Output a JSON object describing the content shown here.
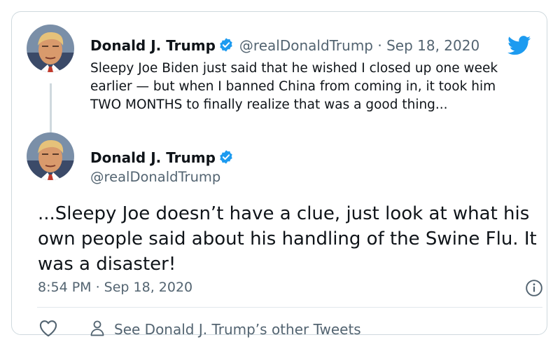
{
  "parent_tweet": {
    "author_name": "Donald J. Trump",
    "handle": "@realDonaldTrump",
    "separator": "·",
    "date": "Sep 18, 2020",
    "text": "Sleepy Joe Biden just said that he wished I closed up one week earlier — but when I banned China from coming in, it took him TWO MONTHS to finally realize that was a good thing..."
  },
  "main_tweet": {
    "author_name": "Donald J. Trump",
    "handle": "@realDonaldTrump",
    "text": "...Sleepy Joe doesn’t have a clue, just look at what his own people said about his handling of the Swine Flu. It was a disaster!",
    "timestamp": "8:54 PM · Sep 18, 2020"
  },
  "actions": {
    "like_icon": "heart-outline-icon",
    "other_tweets_icon": "person-icon",
    "other_tweets_label": "See Donald J. Trump’s other Tweets"
  },
  "icons": {
    "brand": "twitter-bird-icon",
    "verified": "verified-badge-icon",
    "info": "info-icon"
  },
  "colors": {
    "twitter_blue": "#1d9bf0",
    "text_primary": "#0f1419",
    "text_secondary": "#536471",
    "border": "#cfd9de"
  }
}
